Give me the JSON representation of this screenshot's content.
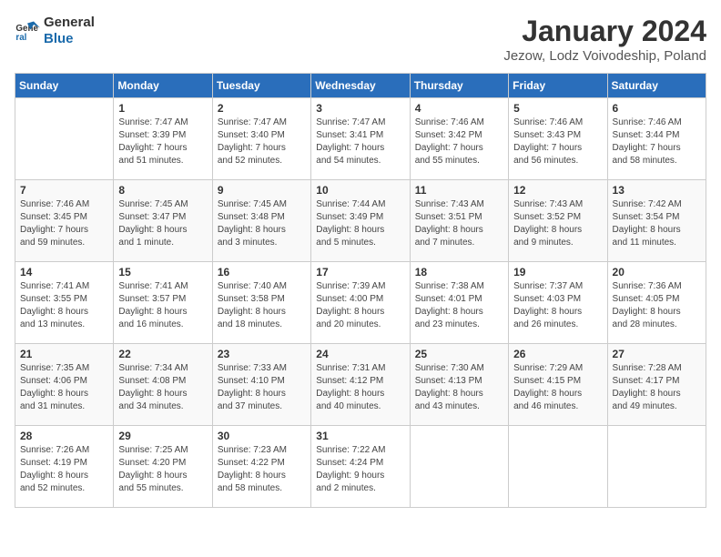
{
  "logo": {
    "line1": "General",
    "line2": "Blue"
  },
  "calendar": {
    "title": "January 2024",
    "subtitle": "Jezow, Lodz Voivodeship, Poland"
  },
  "headers": [
    "Sunday",
    "Monday",
    "Tuesday",
    "Wednesday",
    "Thursday",
    "Friday",
    "Saturday"
  ],
  "weeks": [
    [
      {
        "num": "",
        "info": ""
      },
      {
        "num": "1",
        "info": "Sunrise: 7:47 AM\nSunset: 3:39 PM\nDaylight: 7 hours\nand 51 minutes."
      },
      {
        "num": "2",
        "info": "Sunrise: 7:47 AM\nSunset: 3:40 PM\nDaylight: 7 hours\nand 52 minutes."
      },
      {
        "num": "3",
        "info": "Sunrise: 7:47 AM\nSunset: 3:41 PM\nDaylight: 7 hours\nand 54 minutes."
      },
      {
        "num": "4",
        "info": "Sunrise: 7:46 AM\nSunset: 3:42 PM\nDaylight: 7 hours\nand 55 minutes."
      },
      {
        "num": "5",
        "info": "Sunrise: 7:46 AM\nSunset: 3:43 PM\nDaylight: 7 hours\nand 56 minutes."
      },
      {
        "num": "6",
        "info": "Sunrise: 7:46 AM\nSunset: 3:44 PM\nDaylight: 7 hours\nand 58 minutes."
      }
    ],
    [
      {
        "num": "7",
        "info": "Sunrise: 7:46 AM\nSunset: 3:45 PM\nDaylight: 7 hours\nand 59 minutes."
      },
      {
        "num": "8",
        "info": "Sunrise: 7:45 AM\nSunset: 3:47 PM\nDaylight: 8 hours\nand 1 minute."
      },
      {
        "num": "9",
        "info": "Sunrise: 7:45 AM\nSunset: 3:48 PM\nDaylight: 8 hours\nand 3 minutes."
      },
      {
        "num": "10",
        "info": "Sunrise: 7:44 AM\nSunset: 3:49 PM\nDaylight: 8 hours\nand 5 minutes."
      },
      {
        "num": "11",
        "info": "Sunrise: 7:43 AM\nSunset: 3:51 PM\nDaylight: 8 hours\nand 7 minutes."
      },
      {
        "num": "12",
        "info": "Sunrise: 7:43 AM\nSunset: 3:52 PM\nDaylight: 8 hours\nand 9 minutes."
      },
      {
        "num": "13",
        "info": "Sunrise: 7:42 AM\nSunset: 3:54 PM\nDaylight: 8 hours\nand 11 minutes."
      }
    ],
    [
      {
        "num": "14",
        "info": "Sunrise: 7:41 AM\nSunset: 3:55 PM\nDaylight: 8 hours\nand 13 minutes."
      },
      {
        "num": "15",
        "info": "Sunrise: 7:41 AM\nSunset: 3:57 PM\nDaylight: 8 hours\nand 16 minutes."
      },
      {
        "num": "16",
        "info": "Sunrise: 7:40 AM\nSunset: 3:58 PM\nDaylight: 8 hours\nand 18 minutes."
      },
      {
        "num": "17",
        "info": "Sunrise: 7:39 AM\nSunset: 4:00 PM\nDaylight: 8 hours\nand 20 minutes."
      },
      {
        "num": "18",
        "info": "Sunrise: 7:38 AM\nSunset: 4:01 PM\nDaylight: 8 hours\nand 23 minutes."
      },
      {
        "num": "19",
        "info": "Sunrise: 7:37 AM\nSunset: 4:03 PM\nDaylight: 8 hours\nand 26 minutes."
      },
      {
        "num": "20",
        "info": "Sunrise: 7:36 AM\nSunset: 4:05 PM\nDaylight: 8 hours\nand 28 minutes."
      }
    ],
    [
      {
        "num": "21",
        "info": "Sunrise: 7:35 AM\nSunset: 4:06 PM\nDaylight: 8 hours\nand 31 minutes."
      },
      {
        "num": "22",
        "info": "Sunrise: 7:34 AM\nSunset: 4:08 PM\nDaylight: 8 hours\nand 34 minutes."
      },
      {
        "num": "23",
        "info": "Sunrise: 7:33 AM\nSunset: 4:10 PM\nDaylight: 8 hours\nand 37 minutes."
      },
      {
        "num": "24",
        "info": "Sunrise: 7:31 AM\nSunset: 4:12 PM\nDaylight: 8 hours\nand 40 minutes."
      },
      {
        "num": "25",
        "info": "Sunrise: 7:30 AM\nSunset: 4:13 PM\nDaylight: 8 hours\nand 43 minutes."
      },
      {
        "num": "26",
        "info": "Sunrise: 7:29 AM\nSunset: 4:15 PM\nDaylight: 8 hours\nand 46 minutes."
      },
      {
        "num": "27",
        "info": "Sunrise: 7:28 AM\nSunset: 4:17 PM\nDaylight: 8 hours\nand 49 minutes."
      }
    ],
    [
      {
        "num": "28",
        "info": "Sunrise: 7:26 AM\nSunset: 4:19 PM\nDaylight: 8 hours\nand 52 minutes."
      },
      {
        "num": "29",
        "info": "Sunrise: 7:25 AM\nSunset: 4:20 PM\nDaylight: 8 hours\nand 55 minutes."
      },
      {
        "num": "30",
        "info": "Sunrise: 7:23 AM\nSunset: 4:22 PM\nDaylight: 8 hours\nand 58 minutes."
      },
      {
        "num": "31",
        "info": "Sunrise: 7:22 AM\nSunset: 4:24 PM\nDaylight: 9 hours\nand 2 minutes."
      },
      {
        "num": "",
        "info": ""
      },
      {
        "num": "",
        "info": ""
      },
      {
        "num": "",
        "info": ""
      }
    ]
  ]
}
